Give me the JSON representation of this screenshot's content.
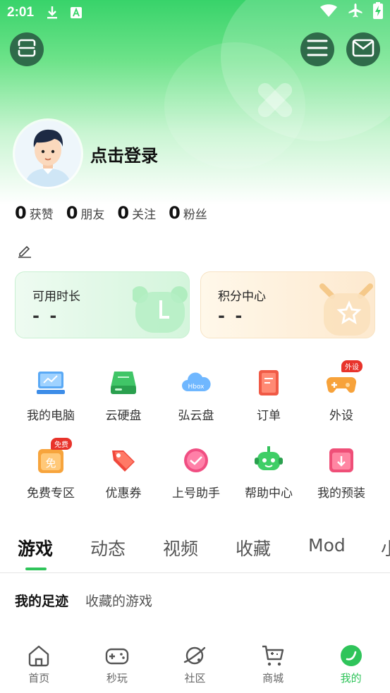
{
  "status_bar": {
    "time": "2:01",
    "icons": [
      "download-icon",
      "font-a-icon",
      "wifi-icon",
      "airplane-icon",
      "battery-charging-icon"
    ]
  },
  "header": {
    "scan_icon": "scan-icon",
    "menu_icon": "menu-icon",
    "mail_icon": "mail-icon"
  },
  "profile": {
    "login_label": "点击登录"
  },
  "stats": [
    {
      "value": "0",
      "label": "获赞"
    },
    {
      "value": "0",
      "label": "朋友"
    },
    {
      "value": "0",
      "label": "关注"
    },
    {
      "value": "0",
      "label": "粉丝"
    }
  ],
  "cards": {
    "time": {
      "title": "可用时长",
      "value": "- -"
    },
    "points": {
      "title": "积分中心",
      "value": "- -"
    }
  },
  "grid": {
    "row1": [
      {
        "label": "我的电脑",
        "icon": "computer-icon"
      },
      {
        "label": "云硬盘",
        "icon": "cloud-disk-icon"
      },
      {
        "label": "弘云盘",
        "icon": "hbox-cloud-icon",
        "icon_text": "Hbox"
      },
      {
        "label": "订单",
        "icon": "order-icon"
      },
      {
        "label": "外设",
        "icon": "gamepad-icon",
        "badge": "外设"
      }
    ],
    "row2": [
      {
        "label": "免费专区",
        "icon": "free-zone-icon",
        "badge": "免费",
        "icon_text": "免"
      },
      {
        "label": "优惠券",
        "icon": "coupon-icon"
      },
      {
        "label": "上号助手",
        "icon": "login-helper-icon"
      },
      {
        "label": "帮助中心",
        "icon": "help-robot-icon"
      },
      {
        "label": "我的预装",
        "icon": "preinstall-icon"
      }
    ]
  },
  "tabs": [
    "游戏",
    "动态",
    "视频",
    "收藏",
    "Mod",
    "小"
  ],
  "subtabs": [
    "我的足迹",
    "收藏的游戏"
  ],
  "bottom_nav": [
    {
      "label": "首页",
      "icon": "home-icon"
    },
    {
      "label": "秒玩",
      "icon": "gamepad-icon"
    },
    {
      "label": "社区",
      "icon": "planet-icon"
    },
    {
      "label": "商城",
      "icon": "cart-icon"
    },
    {
      "label": "我的",
      "icon": "profile-leaf-icon"
    }
  ],
  "colors": {
    "accent": "#2fc45a",
    "header_button": "#2f6b4a",
    "badge": "#e8332b"
  }
}
